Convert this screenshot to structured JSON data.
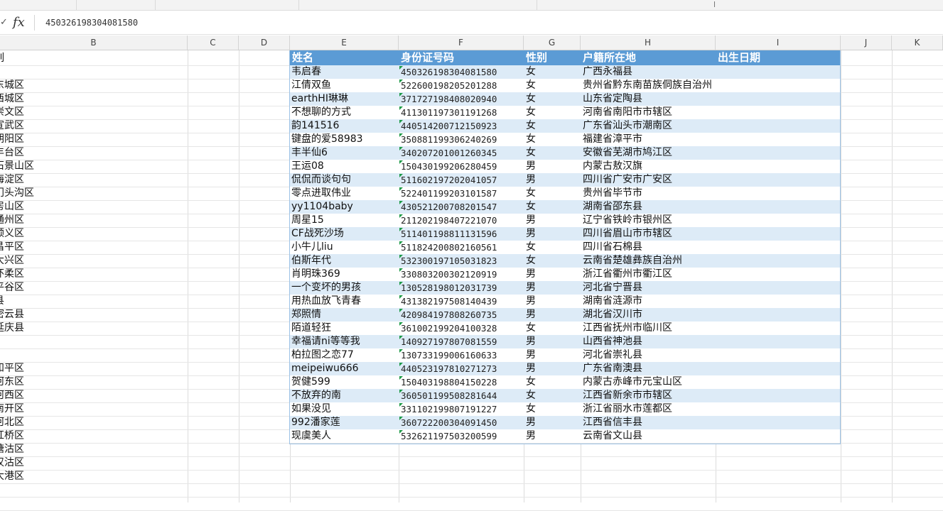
{
  "formula_bar": {
    "cancel_glyph": "✓",
    "fx_label": "fx",
    "value": "450326198304081580"
  },
  "columns": [
    "B",
    "C",
    "D",
    "E",
    "F",
    "G",
    "H",
    "I",
    "J",
    "K"
  ],
  "colB_cells": [
    "列",
    "",
    "东城区",
    "西城区",
    "崇文区",
    "宣武区",
    "朝阳区",
    "丰台区",
    "石景山区",
    "海淀区",
    "门头沟区",
    "房山区",
    "通州区",
    "顺义区",
    "昌平区",
    "大兴区",
    "怀柔区",
    "平谷区",
    "县",
    "密云县",
    "延庆县",
    "",
    "",
    "和平区",
    "河东区",
    "河西区",
    "南开区",
    "河北区",
    "红桥区",
    "塘沽区",
    "汉沽区",
    "大港区"
  ],
  "table": {
    "headers": {
      "name": "姓名",
      "id": "身份证号码",
      "gender": "性别",
      "hukou": "户籍所在地",
      "birth": "出生日期"
    },
    "rows": [
      {
        "name": "韦启春",
        "id": "450326198304081580",
        "gender": "女",
        "hukou": "广西永福县"
      },
      {
        "name": "江倩双鱼",
        "id": "522600198205201288",
        "gender": "女",
        "hukou": "贵州省黔东南苗族侗族自治州"
      },
      {
        "name": "earthHI琳琳",
        "id": "371727198408020940",
        "gender": "女",
        "hukou": "山东省定陶县"
      },
      {
        "name": "不想聊的方式",
        "id": "411301197301191268",
        "gender": "女",
        "hukou": "河南省南阳市市辖区"
      },
      {
        "name": "韵141516",
        "id": "440514200712150923",
        "gender": "女",
        "hukou": "广东省汕头市潮南区"
      },
      {
        "name": "键盘的爱58983",
        "id": "350881199306240269",
        "gender": "女",
        "hukou": "福建省漳平市"
      },
      {
        "name": "丰半仙6",
        "id": "340207201001260345",
        "gender": "女",
        "hukou": "安徽省芜湖市鸠江区"
      },
      {
        "name": "王运08",
        "id": "150430199206280459",
        "gender": "男",
        "hukou": "内蒙古敖汉旗"
      },
      {
        "name": "侃侃而谈句句",
        "id": "511602197202041057",
        "gender": "男",
        "hukou": "四川省广安市广安区"
      },
      {
        "name": "零点进取伟业",
        "id": "522401199203101587",
        "gender": "女",
        "hukou": "贵州省毕节市"
      },
      {
        "name": "yy1104baby",
        "id": "430521200708201547",
        "gender": "女",
        "hukou": "湖南省邵东县"
      },
      {
        "name": "周星15",
        "id": "211202198407221070",
        "gender": "男",
        "hukou": "辽宁省铁岭市银州区"
      },
      {
        "name": "CF战死沙场",
        "id": "511401198811131596",
        "gender": "男",
        "hukou": "四川省眉山市市辖区"
      },
      {
        "name": "小牛儿liu",
        "id": "511824200802160561",
        "gender": "女",
        "hukou": "四川省石棉县"
      },
      {
        "name": "伯斯年代",
        "id": "532300197105031823",
        "gender": "女",
        "hukou": "云南省楚雄彝族自治州"
      },
      {
        "name": "肖明珠369",
        "id": "330803200302120919",
        "gender": "男",
        "hukou": "浙江省衢州市衢江区"
      },
      {
        "name": "一个变坏的男孩",
        "id": "130528198012031739",
        "gender": "男",
        "hukou": "河北省宁晋县"
      },
      {
        "name": "用热血放飞青春",
        "id": "431382197508140439",
        "gender": "男",
        "hukou": "湖南省涟源市"
      },
      {
        "name": "郑照情",
        "id": "420984197808260735",
        "gender": "男",
        "hukou": "湖北省汉川市"
      },
      {
        "name": "陌道轻狂",
        "id": "361002199204100328",
        "gender": "女",
        "hukou": "江西省抚州市临川区"
      },
      {
        "name": "幸福请ni等等我",
        "id": "140927197807081559",
        "gender": "男",
        "hukou": "山西省神池县"
      },
      {
        "name": "柏拉图之恋77",
        "id": "130733199006160633",
        "gender": "男",
        "hukou": "河北省崇礼县"
      },
      {
        "name": "meipeiwu666",
        "id": "440523197810271273",
        "gender": "男",
        "hukou": "广东省南澳县"
      },
      {
        "name": "贺健599",
        "id": "150403198804150228",
        "gender": "女",
        "hukou": "内蒙古赤峰市元宝山区"
      },
      {
        "name": "不放弃的南",
        "id": "360501199508281644",
        "gender": "女",
        "hukou": "江西省新余市市辖区"
      },
      {
        "name": "如果没见",
        "id": "331102199807191227",
        "gender": "女",
        "hukou": "浙江省丽水市莲都区"
      },
      {
        "name": "992潘家莲",
        "id": "360722200304091450",
        "gender": "男",
        "hukou": "江西省信丰县"
      },
      {
        "name": "现虞美人",
        "id": "532621197503200599",
        "gender": "男",
        "hukou": "云南省文山县"
      }
    ]
  },
  "colors": {
    "header_bg": "#5b9bd5",
    "band_bg": "#ddebf7",
    "indicator": "#1e9b48"
  }
}
